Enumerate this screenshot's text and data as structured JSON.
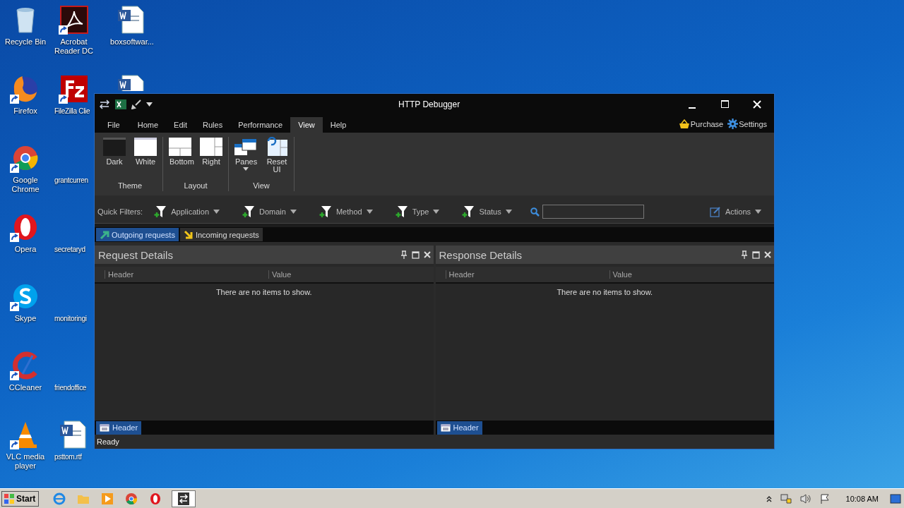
{
  "desktop": {
    "icons": [
      {
        "label": "Recycle Bin",
        "shortcut": false
      },
      {
        "label": "Firefox",
        "shortcut": true
      },
      {
        "label": "Google Chrome",
        "shortcut": true
      },
      {
        "label": "Opera",
        "shortcut": true
      },
      {
        "label": "Skype",
        "shortcut": true
      },
      {
        "label": "CCleaner",
        "shortcut": true
      },
      {
        "label": "VLC media player",
        "shortcut": true
      },
      {
        "label": "Acrobat Reader DC",
        "shortcut": true
      },
      {
        "label": "FileZilla Clie",
        "shortcut": true
      },
      {
        "label": "grantcurren",
        "shortcut": false
      },
      {
        "label": "secretaryd",
        "shortcut": false
      },
      {
        "label": "monitoringi",
        "shortcut": false
      },
      {
        "label": "friendoffice",
        "shortcut": false
      },
      {
        "label": "psttom.rtf",
        "shortcut": false
      },
      {
        "label": "boxsoftwar...",
        "shortcut": false
      }
    ]
  },
  "window": {
    "title": "HTTP Debugger",
    "menu_tabs": [
      {
        "label": "File",
        "selected": false
      },
      {
        "label": "Home",
        "selected": false
      },
      {
        "label": "Edit",
        "selected": false
      },
      {
        "label": "Rules",
        "selected": false
      },
      {
        "label": "Performance",
        "selected": false
      },
      {
        "label": "View",
        "selected": true
      },
      {
        "label": "Help",
        "selected": false
      }
    ],
    "links": [
      "Purchase",
      "Settings"
    ]
  },
  "ribbon": {
    "groups": [
      {
        "label": "Theme",
        "buttons": [
          {
            "label": "Dark",
            "dropdown": false
          },
          {
            "label": "White",
            "dropdown": false
          }
        ]
      },
      {
        "label": "Layout",
        "buttons": [
          {
            "label": "Bottom",
            "dropdown": false
          },
          {
            "label": "Right",
            "dropdown": false
          }
        ]
      },
      {
        "label": "View",
        "buttons": [
          {
            "label": "Panes",
            "dropdown": true
          },
          {
            "label": "Reset UI",
            "dropdown": false
          }
        ]
      }
    ]
  },
  "quick_filters": {
    "label": "Quick Filters:",
    "filters": [
      "Application",
      "Domain",
      "Method",
      "Type",
      "Status"
    ],
    "actions": "Actions"
  },
  "request_tabs": [
    {
      "label": "Outgoing requests",
      "selected": true
    },
    {
      "label": "Incoming requests",
      "selected": false
    }
  ],
  "panes": [
    {
      "title": "Request Details",
      "columns": [
        "Header",
        "Value"
      ],
      "empty_text": "There are no items to show.",
      "bottom_tabs": [
        {
          "label": "Header",
          "selected": true
        }
      ]
    },
    {
      "title": "Response Details",
      "columns": [
        "Header",
        "Value"
      ],
      "empty_text": "There are no items to show.",
      "bottom_tabs": [
        {
          "label": "Header",
          "selected": true
        }
      ]
    }
  ],
  "status_bar": "Ready",
  "taskbar": {
    "start": "Start",
    "clock": "10:08 AM"
  }
}
